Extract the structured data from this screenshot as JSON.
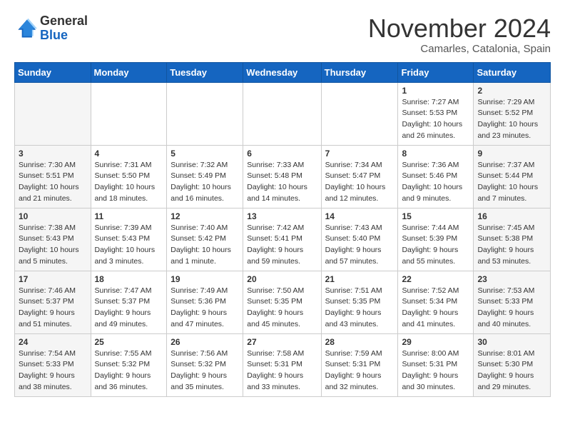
{
  "logo": {
    "general": "General",
    "blue": "Blue"
  },
  "title": "November 2024",
  "location": "Camarles, Catalonia, Spain",
  "days_header": [
    "Sunday",
    "Monday",
    "Tuesday",
    "Wednesday",
    "Thursday",
    "Friday",
    "Saturday"
  ],
  "weeks": [
    [
      {
        "day": "",
        "info": ""
      },
      {
        "day": "",
        "info": ""
      },
      {
        "day": "",
        "info": ""
      },
      {
        "day": "",
        "info": ""
      },
      {
        "day": "",
        "info": ""
      },
      {
        "day": "1",
        "info": "Sunrise: 7:27 AM\nSunset: 5:53 PM\nDaylight: 10 hours\nand 26 minutes."
      },
      {
        "day": "2",
        "info": "Sunrise: 7:29 AM\nSunset: 5:52 PM\nDaylight: 10 hours\nand 23 minutes."
      }
    ],
    [
      {
        "day": "3",
        "info": "Sunrise: 7:30 AM\nSunset: 5:51 PM\nDaylight: 10 hours\nand 21 minutes."
      },
      {
        "day": "4",
        "info": "Sunrise: 7:31 AM\nSunset: 5:50 PM\nDaylight: 10 hours\nand 18 minutes."
      },
      {
        "day": "5",
        "info": "Sunrise: 7:32 AM\nSunset: 5:49 PM\nDaylight: 10 hours\nand 16 minutes."
      },
      {
        "day": "6",
        "info": "Sunrise: 7:33 AM\nSunset: 5:48 PM\nDaylight: 10 hours\nand 14 minutes."
      },
      {
        "day": "7",
        "info": "Sunrise: 7:34 AM\nSunset: 5:47 PM\nDaylight: 10 hours\nand 12 minutes."
      },
      {
        "day": "8",
        "info": "Sunrise: 7:36 AM\nSunset: 5:46 PM\nDaylight: 10 hours\nand 9 minutes."
      },
      {
        "day": "9",
        "info": "Sunrise: 7:37 AM\nSunset: 5:44 PM\nDaylight: 10 hours\nand 7 minutes."
      }
    ],
    [
      {
        "day": "10",
        "info": "Sunrise: 7:38 AM\nSunset: 5:43 PM\nDaylight: 10 hours\nand 5 minutes."
      },
      {
        "day": "11",
        "info": "Sunrise: 7:39 AM\nSunset: 5:43 PM\nDaylight: 10 hours\nand 3 minutes."
      },
      {
        "day": "12",
        "info": "Sunrise: 7:40 AM\nSunset: 5:42 PM\nDaylight: 10 hours\nand 1 minute."
      },
      {
        "day": "13",
        "info": "Sunrise: 7:42 AM\nSunset: 5:41 PM\nDaylight: 9 hours\nand 59 minutes."
      },
      {
        "day": "14",
        "info": "Sunrise: 7:43 AM\nSunset: 5:40 PM\nDaylight: 9 hours\nand 57 minutes."
      },
      {
        "day": "15",
        "info": "Sunrise: 7:44 AM\nSunset: 5:39 PM\nDaylight: 9 hours\nand 55 minutes."
      },
      {
        "day": "16",
        "info": "Sunrise: 7:45 AM\nSunset: 5:38 PM\nDaylight: 9 hours\nand 53 minutes."
      }
    ],
    [
      {
        "day": "17",
        "info": "Sunrise: 7:46 AM\nSunset: 5:37 PM\nDaylight: 9 hours\nand 51 minutes."
      },
      {
        "day": "18",
        "info": "Sunrise: 7:47 AM\nSunset: 5:37 PM\nDaylight: 9 hours\nand 49 minutes."
      },
      {
        "day": "19",
        "info": "Sunrise: 7:49 AM\nSunset: 5:36 PM\nDaylight: 9 hours\nand 47 minutes."
      },
      {
        "day": "20",
        "info": "Sunrise: 7:50 AM\nSunset: 5:35 PM\nDaylight: 9 hours\nand 45 minutes."
      },
      {
        "day": "21",
        "info": "Sunrise: 7:51 AM\nSunset: 5:35 PM\nDaylight: 9 hours\nand 43 minutes."
      },
      {
        "day": "22",
        "info": "Sunrise: 7:52 AM\nSunset: 5:34 PM\nDaylight: 9 hours\nand 41 minutes."
      },
      {
        "day": "23",
        "info": "Sunrise: 7:53 AM\nSunset: 5:33 PM\nDaylight: 9 hours\nand 40 minutes."
      }
    ],
    [
      {
        "day": "24",
        "info": "Sunrise: 7:54 AM\nSunset: 5:33 PM\nDaylight: 9 hours\nand 38 minutes."
      },
      {
        "day": "25",
        "info": "Sunrise: 7:55 AM\nSunset: 5:32 PM\nDaylight: 9 hours\nand 36 minutes."
      },
      {
        "day": "26",
        "info": "Sunrise: 7:56 AM\nSunset: 5:32 PM\nDaylight: 9 hours\nand 35 minutes."
      },
      {
        "day": "27",
        "info": "Sunrise: 7:58 AM\nSunset: 5:31 PM\nDaylight: 9 hours\nand 33 minutes."
      },
      {
        "day": "28",
        "info": "Sunrise: 7:59 AM\nSunset: 5:31 PM\nDaylight: 9 hours\nand 32 minutes."
      },
      {
        "day": "29",
        "info": "Sunrise: 8:00 AM\nSunset: 5:31 PM\nDaylight: 9 hours\nand 30 minutes."
      },
      {
        "day": "30",
        "info": "Sunrise: 8:01 AM\nSunset: 5:30 PM\nDaylight: 9 hours\nand 29 minutes."
      }
    ]
  ]
}
